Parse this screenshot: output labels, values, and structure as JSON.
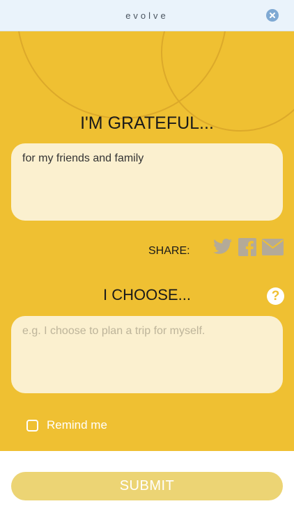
{
  "header": {
    "title": "evolve"
  },
  "grateful": {
    "heading": "I'M GRATEFUL...",
    "value": "for my friends and family"
  },
  "share": {
    "label": "SHARE:",
    "icons": [
      "twitter-icon",
      "facebook-icon",
      "mail-icon"
    ]
  },
  "choose": {
    "heading": "I CHOOSE...",
    "placeholder": "e.g. I choose to plan a trip for myself."
  },
  "remind": {
    "label": "Remind me",
    "checked": false
  },
  "submit": {
    "label": "SUBMIT"
  },
  "colors": {
    "primary_yellow": "#efc032",
    "input_bg": "#fbf0cf",
    "submit_bg": "#ecd474",
    "icon_gray": "#b4aa98",
    "header_bg": "#eaf3fb"
  }
}
